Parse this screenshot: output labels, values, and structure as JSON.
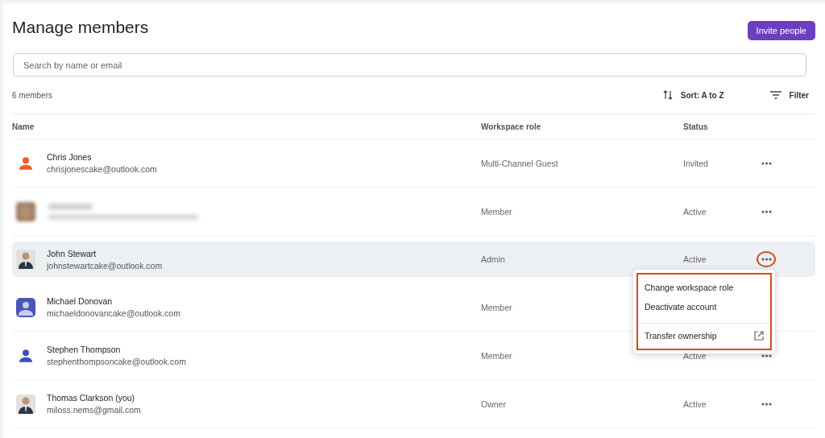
{
  "title": "Manage members",
  "invite_button": "Invite people",
  "search": {
    "placeholder": "Search by name or email"
  },
  "member_count": "6 members",
  "sort": "Sort: A to Z",
  "filter": "Filter",
  "columns": [
    "Name",
    "Workspace role",
    "Status"
  ],
  "rows": [
    {
      "avatar": {
        "kind": "person-icon",
        "color": "#f15a2b"
      },
      "name": "Chris Jones",
      "email": "chrisjonescake@outlook.com",
      "role": "Multi-Channel Guest",
      "status": "Invited",
      "selected": false,
      "blurred": false
    },
    {
      "role": "Member",
      "status": "Active",
      "selected": false,
      "blurred": true
    },
    {
      "name": "John Stewart",
      "email": "johnstewartcake@outlook.com",
      "role": "Admin",
      "status": "Active",
      "selected": true,
      "blurred": false,
      "menu_open": true
    },
    {
      "avatar": {
        "kind": "solid-person",
        "color": "#4a55b8"
      },
      "name": "Michael Donovan",
      "email": "michaeldonovancake@outlook.com",
      "role": "Member",
      "selected": false,
      "blurred": false
    },
    {
      "avatar": {
        "kind": "person-icon",
        "color": "#3f4fc0"
      },
      "name": "Stephen Thompson",
      "email": "stephenthompsoncake@outlook.com",
      "role": "Member",
      "status": "Active",
      "selected": false,
      "blurred": false
    },
    {
      "name": "Thomas Clarkson (you)",
      "email": "miloss.nems@gmail.com",
      "role": "Owner",
      "status": "Active",
      "selected": false,
      "blurred": false
    }
  ],
  "menu": {
    "highlighted": true,
    "items": [
      {
        "label": "Change workspace role",
        "kind": "plain"
      },
      {
        "label": "Deactivate account",
        "kind": "plain"
      },
      {
        "label": "Transfer ownership",
        "kind": "external"
      }
    ]
  }
}
